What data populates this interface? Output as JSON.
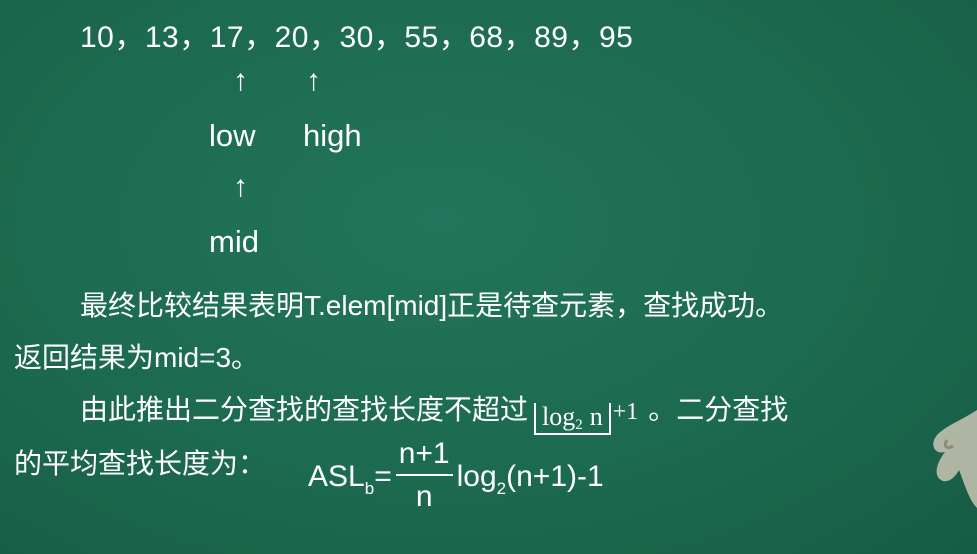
{
  "sequence": "10，13，17，20，30，55，68，89，95",
  "arrows": {
    "up": "↑"
  },
  "labels": {
    "low": "low",
    "high": "high",
    "mid": "mid"
  },
  "paragraphs": {
    "line1": "最终比较结果表明T.elem[mid]正是待查元素，查找成功。",
    "line2": "返回结果为mid=3。",
    "line3_prefix": "由此推出二分查找的查找长度不超过",
    "line3_log": "log",
    "line3_sub": "2",
    "line3_n": "n",
    "line3_plus": "+1",
    "line3_suffix": "。二分查找",
    "line4": "的平均查找长度为："
  },
  "formula": {
    "asl": "ASL",
    "asl_sub": "b",
    "eq": "=",
    "numerator": "n+1",
    "denominator": "n",
    "log": "log",
    "log_sub": "2",
    "tail": "(n+1)-1"
  }
}
